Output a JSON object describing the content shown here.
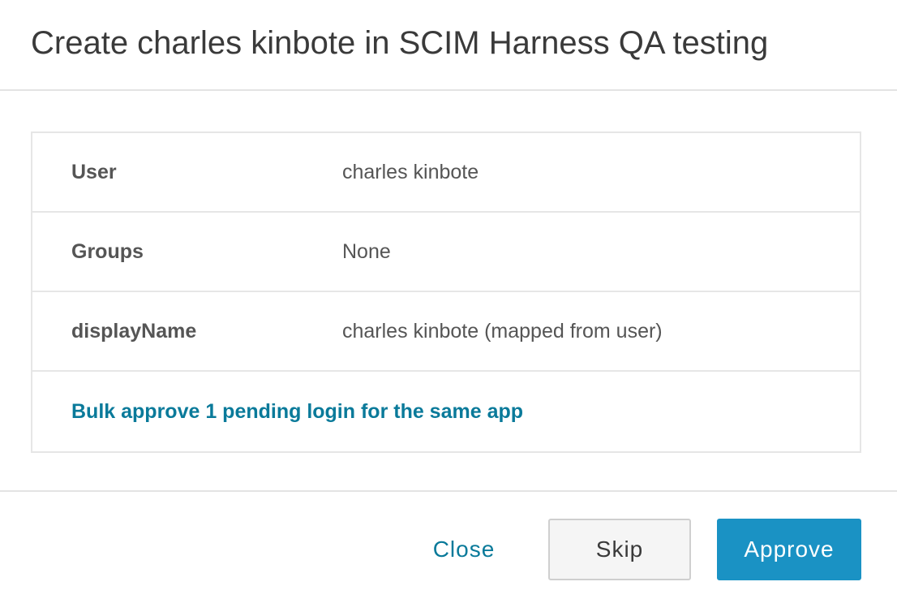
{
  "dialog": {
    "title": "Create charles kinbote in SCIM Harness QA testing"
  },
  "details": {
    "rows": [
      {
        "key": "User",
        "value": "charles kinbote"
      },
      {
        "key": "Groups",
        "value": "None"
      },
      {
        "key": "displayName",
        "value": "charles kinbote (mapped from user)"
      }
    ],
    "bulk_link": "Bulk approve 1 pending login for the same app"
  },
  "footer": {
    "close_label": "Close",
    "skip_label": "Skip",
    "approve_label": "Approve"
  },
  "colors": {
    "link": "#0a7a9a",
    "primary": "#1a92c4",
    "border": "#e6e6e6",
    "text": "#555555"
  }
}
